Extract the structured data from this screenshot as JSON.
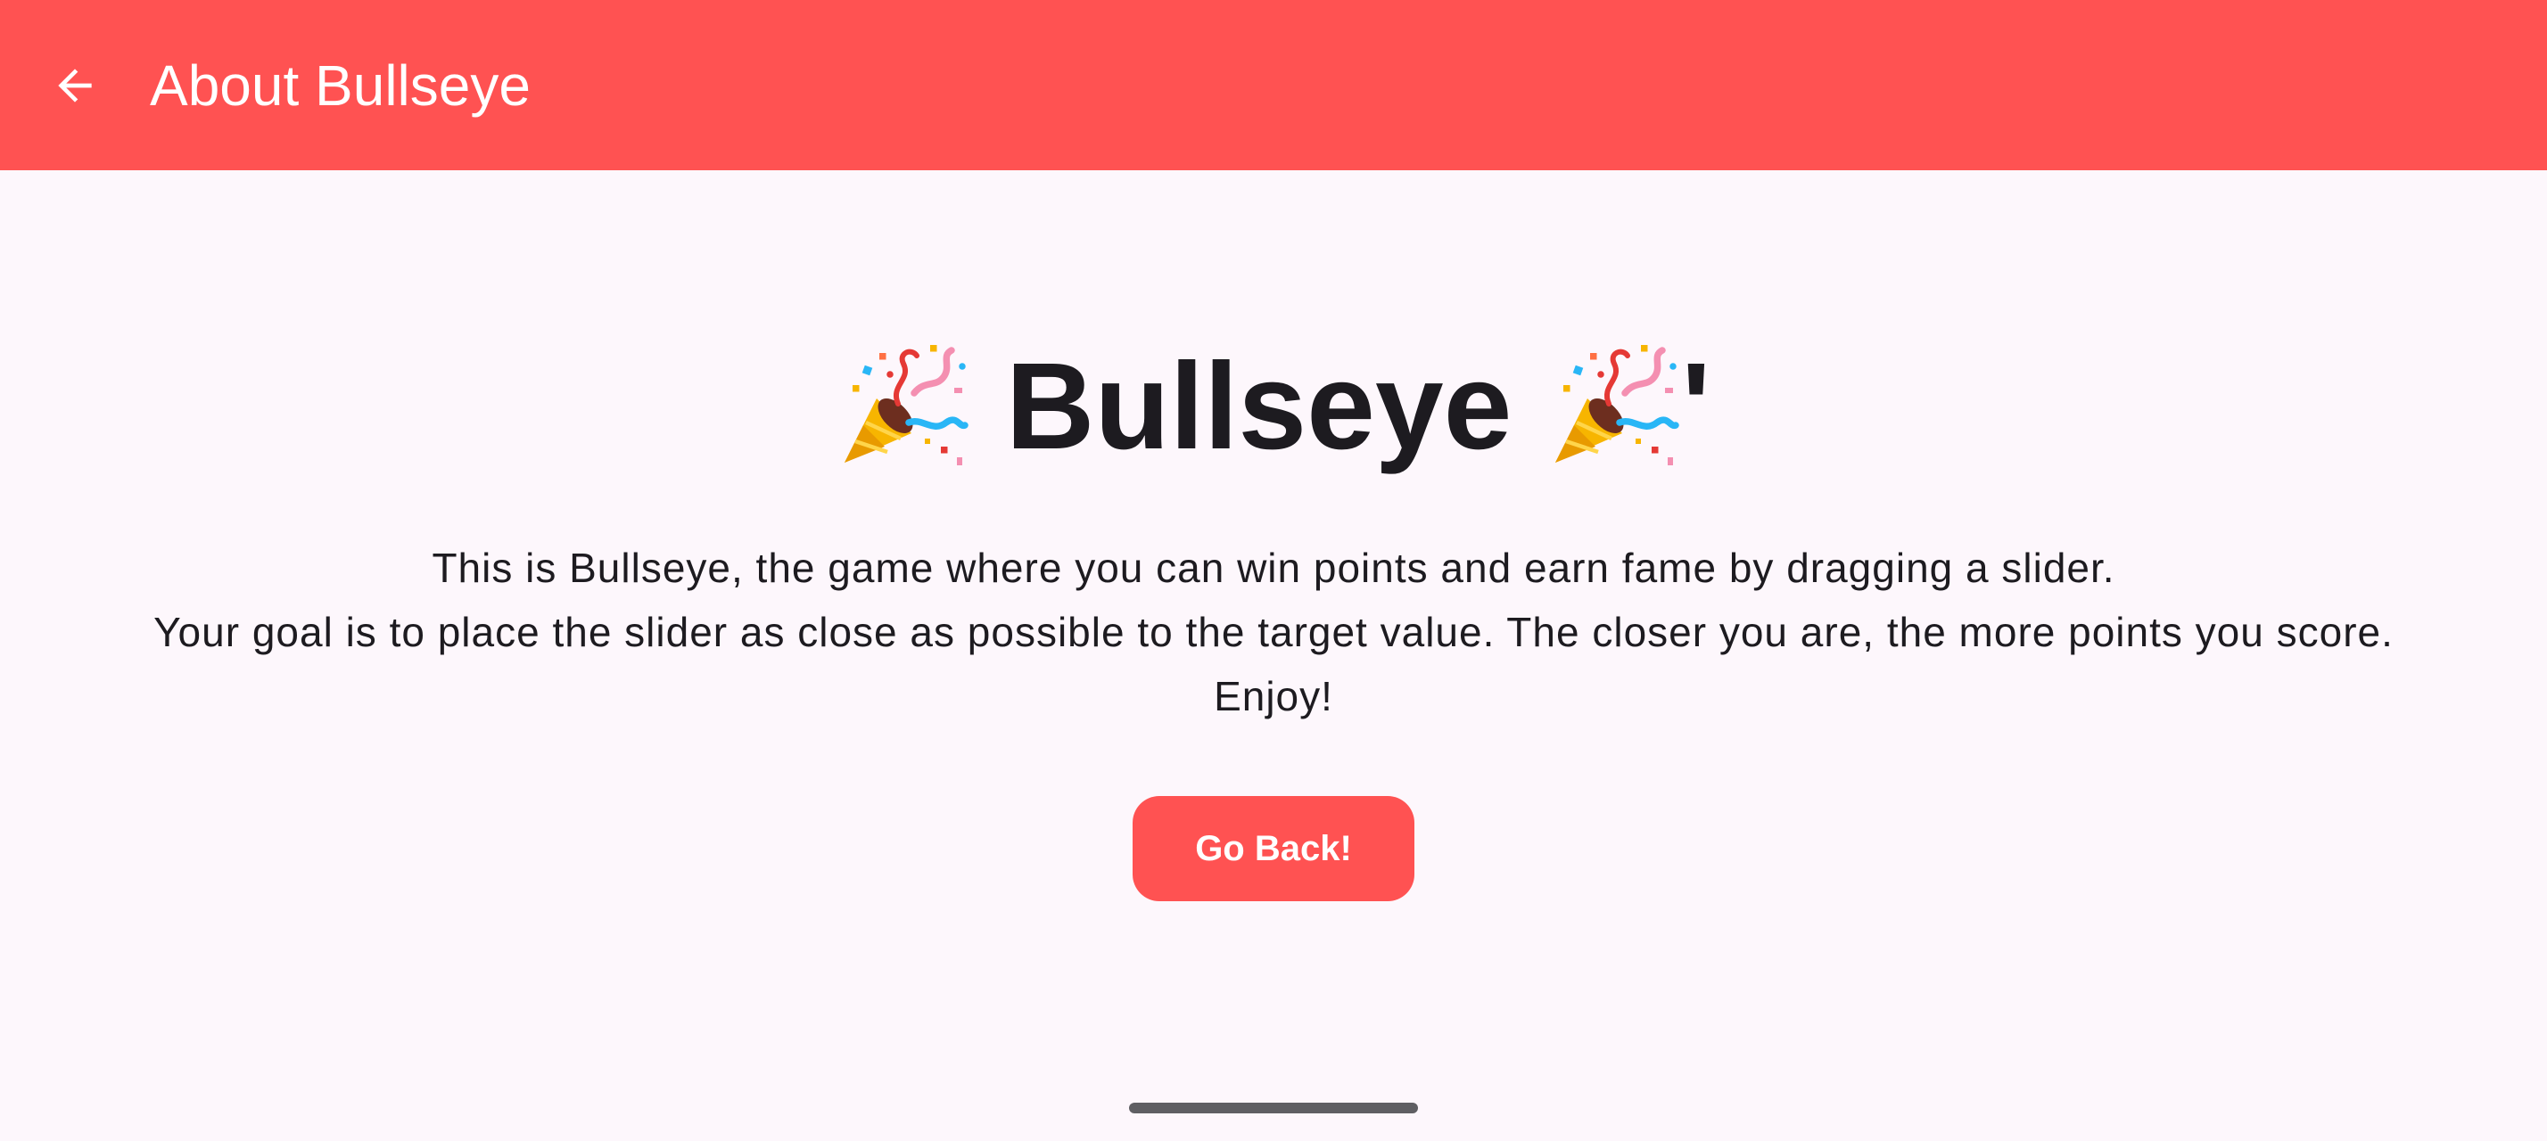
{
  "app_bar": {
    "title": "About Bullseye",
    "back_icon": "arrow-back-icon",
    "background_color": "#FF5252"
  },
  "main": {
    "heading": "Bullseye",
    "heading_suffix": "'",
    "heading_icon": "party-popper-icon",
    "description_lines": [
      "This is Bullseye, the game where you can win points and earn fame by dragging a slider.",
      "Your goal is to place the slider as close as possible to the target value. The closer you are, the more points you score.",
      "Enjoy!"
    ],
    "go_back_label": "Go Back!",
    "accent_color": "#FF5252"
  },
  "system": {
    "nav_handle": "gesture-navigation-handle"
  }
}
